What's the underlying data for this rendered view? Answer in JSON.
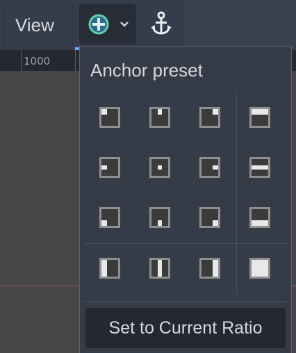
{
  "toolbar": {
    "view_label": "View",
    "anchor_mode_button": {
      "icon": "add-circle-icon",
      "dropdown_icon": "chevron-down-icon"
    },
    "anchor_button": {
      "icon": "anchor-icon"
    }
  },
  "ruler": {
    "label": "1000"
  },
  "popup": {
    "title": "Anchor preset",
    "presets": [
      "top-left",
      "center-top",
      "top-right",
      "top-wide",
      "center-left",
      "center",
      "center-right",
      "hcenter-wide",
      "bottom-left",
      "center-bottom",
      "bottom-right",
      "bottom-wide",
      "left-wide",
      "vcenter-wide",
      "right-wide",
      "full-rect"
    ],
    "ratio_button_label": "Set to Current Ratio"
  },
  "colors": {
    "toolbar_bg": "#363d4a",
    "popup_bg": "#353b47",
    "accent_green": "#5fd3a8",
    "accent_blue": "#6aa8ff"
  }
}
